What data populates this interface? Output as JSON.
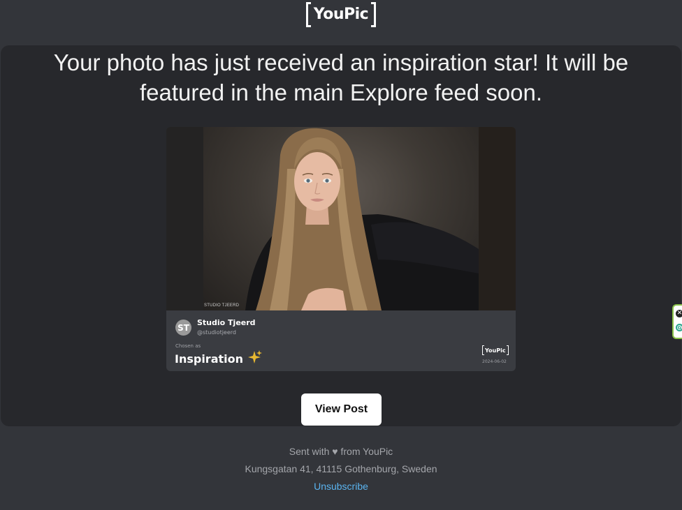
{
  "logo": {
    "text": "YouPic"
  },
  "headline": "Your photo has just received an inspiration star! It will be featured in the main Explore feed soon.",
  "post": {
    "watermark": "STUDIO TJEERD",
    "avatar_initials": "ST",
    "author_name": "Studio Tjeerd",
    "author_handle": "@studiotjeerd",
    "chosen_as_label": "Chosen as",
    "award": "Inspiration",
    "brand": "YouPic",
    "date": "2024-06-02",
    "sparkle_icon": "sparkle-icon"
  },
  "button": {
    "label": "View Post"
  },
  "footer": {
    "sent_with": "Sent with ♥ from YouPic",
    "address": "Kungsgatan 41, 41115 Gothenburg, Sweden",
    "unsubscribe": "Unsubscribe"
  },
  "colors": {
    "background": "#33353a",
    "card": "#27282c",
    "link": "#5ab4f0",
    "sparkle": "#e8b931"
  }
}
